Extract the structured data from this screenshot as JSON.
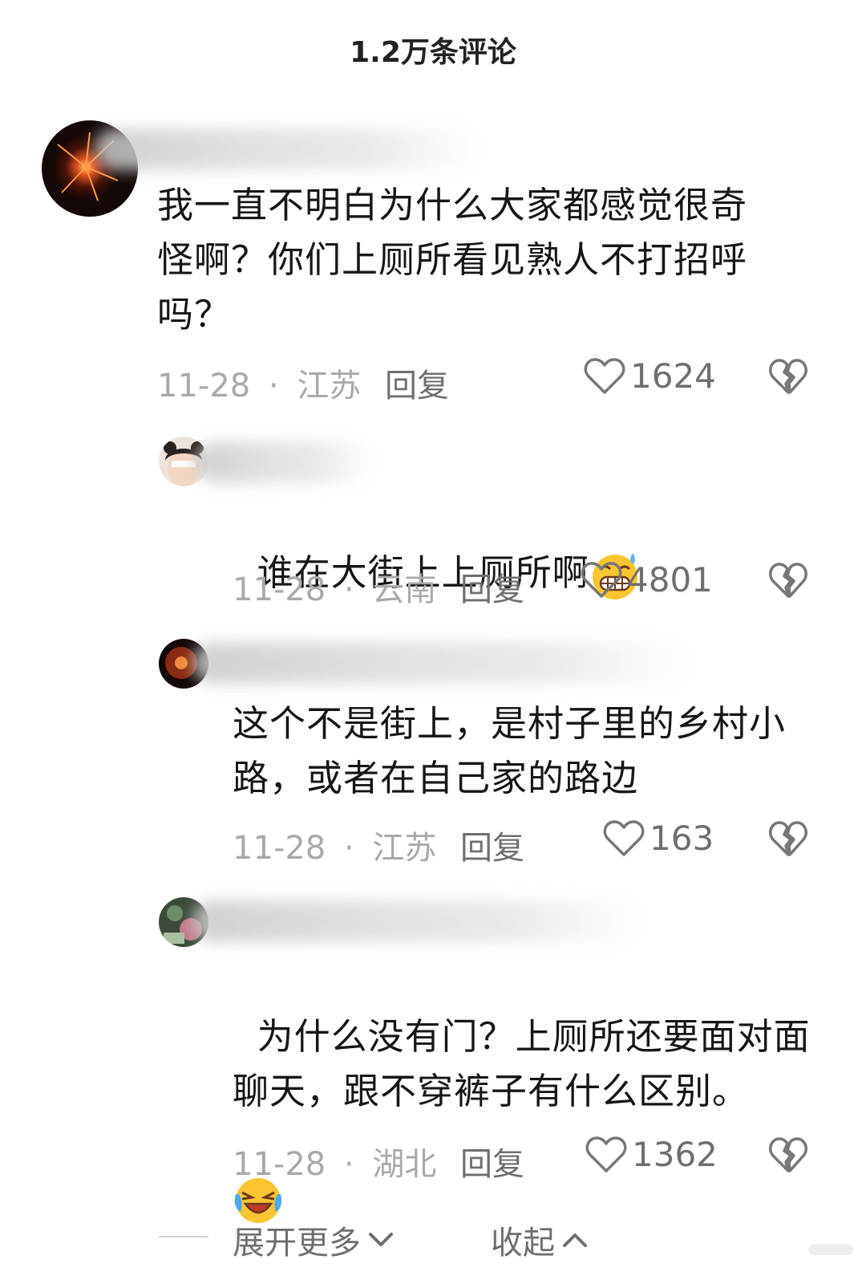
{
  "header": {
    "title": "1.2万条评论"
  },
  "comments": [
    {
      "text": "我一直不明白为什么大家都感觉很奇\n怪啊？你们上厕所看见熟人不打招呼\n吗？",
      "date": "11-28",
      "location": "江苏",
      "reply_label": "回复",
      "likes": "1624"
    },
    {
      "text": "谁在大街上上厕所啊",
      "date": "11-28",
      "location": "云南",
      "reply_label": "回复",
      "likes": "4801",
      "emoji": "grimacing-sweat-emoji"
    },
    {
      "text": "这个不是街上，是村子里的乡村小\n路，或者在自己家的路边",
      "date": "11-28",
      "location": "江苏",
      "reply_label": "回复",
      "likes": "163"
    },
    {
      "text": "为什么没有门？上厕所还要面对面\n聊天，跟不穿裤子有什么区别。",
      "date": "11-28",
      "location": "湖北",
      "reply_label": "回复",
      "likes": "1362",
      "emoji": "laughing-crying-emoji"
    }
  ],
  "footer": {
    "expand_label": "展开更多",
    "collapse_label": "收起"
  },
  "separator": "·",
  "colors": {
    "meta": "#a9a9a9",
    "action": "#6f6f6f",
    "text": "#161616"
  }
}
